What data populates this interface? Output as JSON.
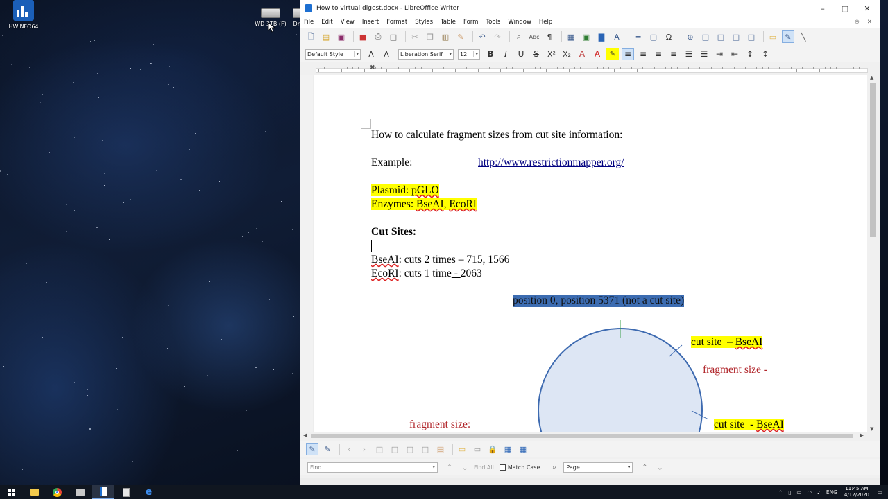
{
  "desktop": {
    "icons": [
      {
        "label": "HWiNFO64",
        "icon": "hwinfo-icon"
      },
      {
        "label": "WD 3TB (F)",
        "icon": "drive-icon"
      },
      {
        "label": "Dr",
        "icon": "drive-icon"
      }
    ]
  },
  "window": {
    "title": "How to virtual digest.docx - LibreOffice Writer",
    "menu": [
      "File",
      "Edit",
      "View",
      "Insert",
      "Format",
      "Styles",
      "Table",
      "Form",
      "Tools",
      "Window",
      "Help"
    ]
  },
  "formatting": {
    "paragraph_style": "Default Style",
    "font_name": "Liberation Serif",
    "font_size": "12"
  },
  "document": {
    "heading": "How to calculate fragment sizes from cut site information:",
    "example_label": "Example:",
    "example_link": "http://www.restrictionmapper.org/",
    "plasmid_label": "Plasmid: ",
    "plasmid_name": "pGLO",
    "enzymes_label": "Enzymes: ",
    "enzyme_1": "BseAI",
    "enzyme_sep": ", ",
    "enzyme_2": "EcoRI",
    "cut_sites_heading": "Cut Sites:",
    "cut_line_1_enzyme": "BseAI",
    "cut_line_1_rest": ": cuts 2 times – 715, 1566",
    "cut_line_2_enzyme": "EcoRI",
    "cut_line_2_rest_a": ": cuts 1 time",
    "cut_line_2_rest_b": " - ",
    "cut_line_2_rest_c": "2063",
    "origin_label": "position 0, position 5371 (not a cut site)",
    "cut_site_label_1_a": "cut site  – ",
    "cut_site_label_1_b": "BseAI",
    "fragment_label_1": "fragment size -",
    "cut_site_label_2_a": "cut site  - ",
    "cut_site_label_2_b": "BseAI",
    "fragment_label_2": "fragment size:"
  },
  "find_toolbar": {
    "find_placeholder": "Find",
    "find_all": "Find All",
    "match_case": "Match Case",
    "search_scope": "Page"
  },
  "taskbar": {
    "language": "ENG",
    "time": "11:45 AM",
    "date": "4/12/2020"
  },
  "colors": {
    "highlight": "#ffff00",
    "selection": "#3c6cb1",
    "annotation_red": "#b1262b",
    "circle_fill": "#dde6f4",
    "circle_stroke": "#3d6ab0"
  }
}
